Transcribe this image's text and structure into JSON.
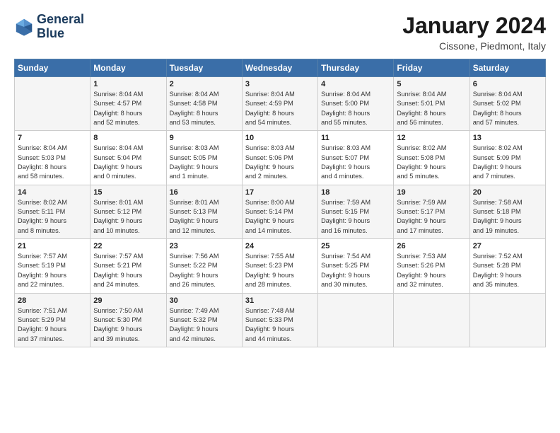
{
  "logo": {
    "line1": "General",
    "line2": "Blue"
  },
  "title": "January 2024",
  "subtitle": "Cissone, Piedmont, Italy",
  "header_days": [
    "Sunday",
    "Monday",
    "Tuesday",
    "Wednesday",
    "Thursday",
    "Friday",
    "Saturday"
  ],
  "weeks": [
    [
      {
        "day": "",
        "info": ""
      },
      {
        "day": "1",
        "info": "Sunrise: 8:04 AM\nSunset: 4:57 PM\nDaylight: 8 hours\nand 52 minutes."
      },
      {
        "day": "2",
        "info": "Sunrise: 8:04 AM\nSunset: 4:58 PM\nDaylight: 8 hours\nand 53 minutes."
      },
      {
        "day": "3",
        "info": "Sunrise: 8:04 AM\nSunset: 4:59 PM\nDaylight: 8 hours\nand 54 minutes."
      },
      {
        "day": "4",
        "info": "Sunrise: 8:04 AM\nSunset: 5:00 PM\nDaylight: 8 hours\nand 55 minutes."
      },
      {
        "day": "5",
        "info": "Sunrise: 8:04 AM\nSunset: 5:01 PM\nDaylight: 8 hours\nand 56 minutes."
      },
      {
        "day": "6",
        "info": "Sunrise: 8:04 AM\nSunset: 5:02 PM\nDaylight: 8 hours\nand 57 minutes."
      }
    ],
    [
      {
        "day": "7",
        "info": "Sunrise: 8:04 AM\nSunset: 5:03 PM\nDaylight: 8 hours\nand 58 minutes."
      },
      {
        "day": "8",
        "info": "Sunrise: 8:04 AM\nSunset: 5:04 PM\nDaylight: 9 hours\nand 0 minutes."
      },
      {
        "day": "9",
        "info": "Sunrise: 8:03 AM\nSunset: 5:05 PM\nDaylight: 9 hours\nand 1 minute."
      },
      {
        "day": "10",
        "info": "Sunrise: 8:03 AM\nSunset: 5:06 PM\nDaylight: 9 hours\nand 2 minutes."
      },
      {
        "day": "11",
        "info": "Sunrise: 8:03 AM\nSunset: 5:07 PM\nDaylight: 9 hours\nand 4 minutes."
      },
      {
        "day": "12",
        "info": "Sunrise: 8:02 AM\nSunset: 5:08 PM\nDaylight: 9 hours\nand 5 minutes."
      },
      {
        "day": "13",
        "info": "Sunrise: 8:02 AM\nSunset: 5:09 PM\nDaylight: 9 hours\nand 7 minutes."
      }
    ],
    [
      {
        "day": "14",
        "info": "Sunrise: 8:02 AM\nSunset: 5:11 PM\nDaylight: 9 hours\nand 8 minutes."
      },
      {
        "day": "15",
        "info": "Sunrise: 8:01 AM\nSunset: 5:12 PM\nDaylight: 9 hours\nand 10 minutes."
      },
      {
        "day": "16",
        "info": "Sunrise: 8:01 AM\nSunset: 5:13 PM\nDaylight: 9 hours\nand 12 minutes."
      },
      {
        "day": "17",
        "info": "Sunrise: 8:00 AM\nSunset: 5:14 PM\nDaylight: 9 hours\nand 14 minutes."
      },
      {
        "day": "18",
        "info": "Sunrise: 7:59 AM\nSunset: 5:15 PM\nDaylight: 9 hours\nand 16 minutes."
      },
      {
        "day": "19",
        "info": "Sunrise: 7:59 AM\nSunset: 5:17 PM\nDaylight: 9 hours\nand 17 minutes."
      },
      {
        "day": "20",
        "info": "Sunrise: 7:58 AM\nSunset: 5:18 PM\nDaylight: 9 hours\nand 19 minutes."
      }
    ],
    [
      {
        "day": "21",
        "info": "Sunrise: 7:57 AM\nSunset: 5:19 PM\nDaylight: 9 hours\nand 22 minutes."
      },
      {
        "day": "22",
        "info": "Sunrise: 7:57 AM\nSunset: 5:21 PM\nDaylight: 9 hours\nand 24 minutes."
      },
      {
        "day": "23",
        "info": "Sunrise: 7:56 AM\nSunset: 5:22 PM\nDaylight: 9 hours\nand 26 minutes."
      },
      {
        "day": "24",
        "info": "Sunrise: 7:55 AM\nSunset: 5:23 PM\nDaylight: 9 hours\nand 28 minutes."
      },
      {
        "day": "25",
        "info": "Sunrise: 7:54 AM\nSunset: 5:25 PM\nDaylight: 9 hours\nand 30 minutes."
      },
      {
        "day": "26",
        "info": "Sunrise: 7:53 AM\nSunset: 5:26 PM\nDaylight: 9 hours\nand 32 minutes."
      },
      {
        "day": "27",
        "info": "Sunrise: 7:52 AM\nSunset: 5:28 PM\nDaylight: 9 hours\nand 35 minutes."
      }
    ],
    [
      {
        "day": "28",
        "info": "Sunrise: 7:51 AM\nSunset: 5:29 PM\nDaylight: 9 hours\nand 37 minutes."
      },
      {
        "day": "29",
        "info": "Sunrise: 7:50 AM\nSunset: 5:30 PM\nDaylight: 9 hours\nand 39 minutes."
      },
      {
        "day": "30",
        "info": "Sunrise: 7:49 AM\nSunset: 5:32 PM\nDaylight: 9 hours\nand 42 minutes."
      },
      {
        "day": "31",
        "info": "Sunrise: 7:48 AM\nSunset: 5:33 PM\nDaylight: 9 hours\nand 44 minutes."
      },
      {
        "day": "",
        "info": ""
      },
      {
        "day": "",
        "info": ""
      },
      {
        "day": "",
        "info": ""
      }
    ]
  ]
}
